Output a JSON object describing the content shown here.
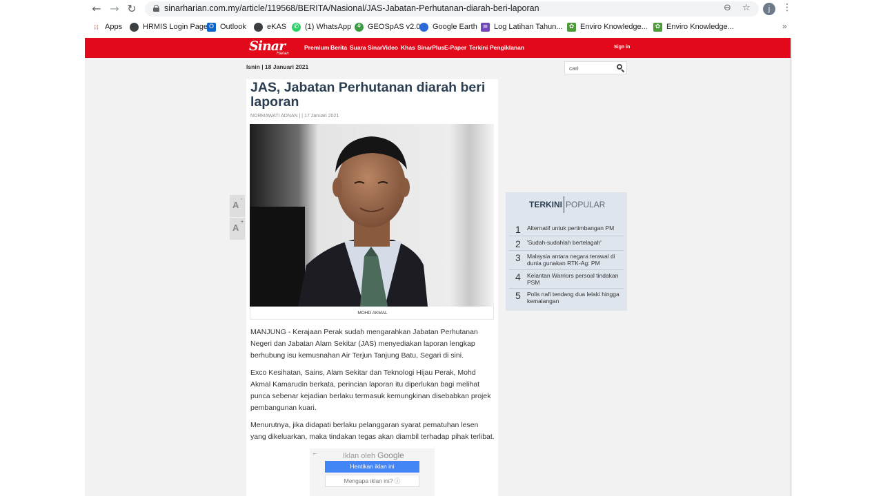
{
  "browser": {
    "url": "sinarharian.com.my/article/119568/BERITA/Nasional/JAS-Jabatan-Perhutanan-diarah-beri-laporan",
    "back_icon": "←",
    "forward_icon": "→",
    "reload_icon": "↻",
    "zoom_icon": "⊖",
    "star_icon": "☆",
    "profile_initial": "j",
    "menu_icon": "⋮",
    "bookmarks": [
      {
        "label": "Apps",
        "icon": "apps-grid-icon",
        "color": "#e94235"
      },
      {
        "label": "HRMIS Login Page",
        "icon": "globe-icon",
        "color": "#3c4043"
      },
      {
        "label": "Outlook",
        "icon": "outlook-icon",
        "color": "#0a64c9"
      },
      {
        "label": "eKAS",
        "icon": "globe-icon",
        "color": "#3c4043"
      },
      {
        "label": "(1) WhatsApp",
        "icon": "whatsapp-icon",
        "color": "#25d366"
      },
      {
        "label": "GEOSpAS v2.0",
        "icon": "geospas-icon",
        "color": "#3a9b41"
      },
      {
        "label": "Google Earth",
        "icon": "google-earth-icon",
        "color": "#2a6ad6"
      },
      {
        "label": "Log Latihan Tahun...",
        "icon": "form-icon",
        "color": "#7248b9"
      },
      {
        "label": "Enviro Knowledge...",
        "icon": "enviro-icon",
        "color": "#4c9a38"
      },
      {
        "label": "Enviro Knowledge...",
        "icon": "enviro-icon",
        "color": "#4c9a38"
      }
    ],
    "bookmarks_more": "»"
  },
  "site": {
    "logo": "Sinar",
    "logo_sub": "Harian",
    "brand_color": "#e2091a",
    "nav": [
      "Premium",
      "Berita",
      "Suara Sinar",
      "Video",
      "Khas",
      "SinarPlus",
      "E-Paper",
      "Terkini",
      "Pengiklanan"
    ],
    "signin": "Sign in",
    "date": "Isnin | 18 Januari 2021",
    "search_placeholder": "cari"
  },
  "article": {
    "headline": "JAS, Jabatan Perhutanan diarah beri laporan",
    "byline": "NORMAWATI ADNAN | | 17 Januari 2021",
    "photo_caption": "MOHD AKMAL",
    "paragraphs": [
      "MANJUNG - Kerajaan Perak sudah mengarahkan Jabatan Perhutanan Negeri dan Jabatan Alam Sekitar (JAS) menyediakan laporan lengkap berhubung isu kemusnahan Air Terjun Tanjung Batu, Segari di sini.",
      "Exco Kesihatan, Sains, Alam Sekitar dan Teknologi Hijau Perak, Mohd Akmal Kamarudin berkata, perincian laporan itu diperlukan bagi melihat punca sebenar kejadian berlaku termasuk kemungkinan disebabkan projek pembangunan kuari.",
      "Menurutnya, jika didapati berlaku pelanggaran syarat pematuhan lesen yang dikeluarkan, maka tindakan tegas akan diambil terhadap pihak terlibat."
    ]
  },
  "font_controls": {
    "decrease": {
      "letter": "A",
      "sign": "-"
    },
    "increase": {
      "letter": "A",
      "sign": "+"
    }
  },
  "ad": {
    "back": "←",
    "label": "Iklan oleh",
    "brand": "Google",
    "stop_button": "Hentikan iklan ini",
    "why_button": "Mengapa iklan ini? ⓘ"
  },
  "sidebar": {
    "tab_active": "TERKINI",
    "tab_inactive": "POPULAR",
    "items": [
      {
        "rank": "1",
        "title": "Alternatif untuk pertimbangan PM"
      },
      {
        "rank": "2",
        "title": "'Sudah-sudahlah bertelagah'"
      },
      {
        "rank": "3",
        "title": "Malaysia antara negara terawal di dunia gunakan RTK-Ag: PM"
      },
      {
        "rank": "4",
        "title": "Kelantan Warriors persoal tindakan PSM"
      },
      {
        "rank": "5",
        "title": "Polis nafi tendang dua lelaki hingga kemalangan"
      }
    ]
  }
}
